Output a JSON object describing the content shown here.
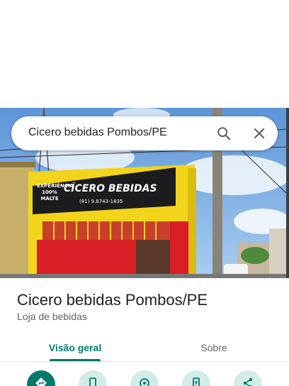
{
  "search": {
    "query": "Cicero bebidas Pombos/PE"
  },
  "storefront": {
    "sign_left_line1": "EXPERIÊNCIA",
    "sign_left_line2": "100% MALTE",
    "sign_name": "CÍCERO BEBIDAS",
    "sign_phone": "(81) 9.8743-1835"
  },
  "place": {
    "title": "Cicero bebidas Pombos/PE",
    "category": "Loja de bebidas"
  },
  "tabs": [
    {
      "label": "Visão geral",
      "selected": true
    },
    {
      "label": "Sobre",
      "selected": false
    }
  ],
  "actions": [
    {
      "icon": "directions-icon"
    },
    {
      "icon": "phone-icon"
    },
    {
      "icon": "nearby-icon"
    },
    {
      "icon": "send-to-phone-icon"
    },
    {
      "icon": "share-icon"
    }
  ],
  "colors": {
    "accent": "#00796b",
    "accent_light": "#d3ece8",
    "wall_yellow": "#f2d41c",
    "door_red": "#d81f26"
  }
}
